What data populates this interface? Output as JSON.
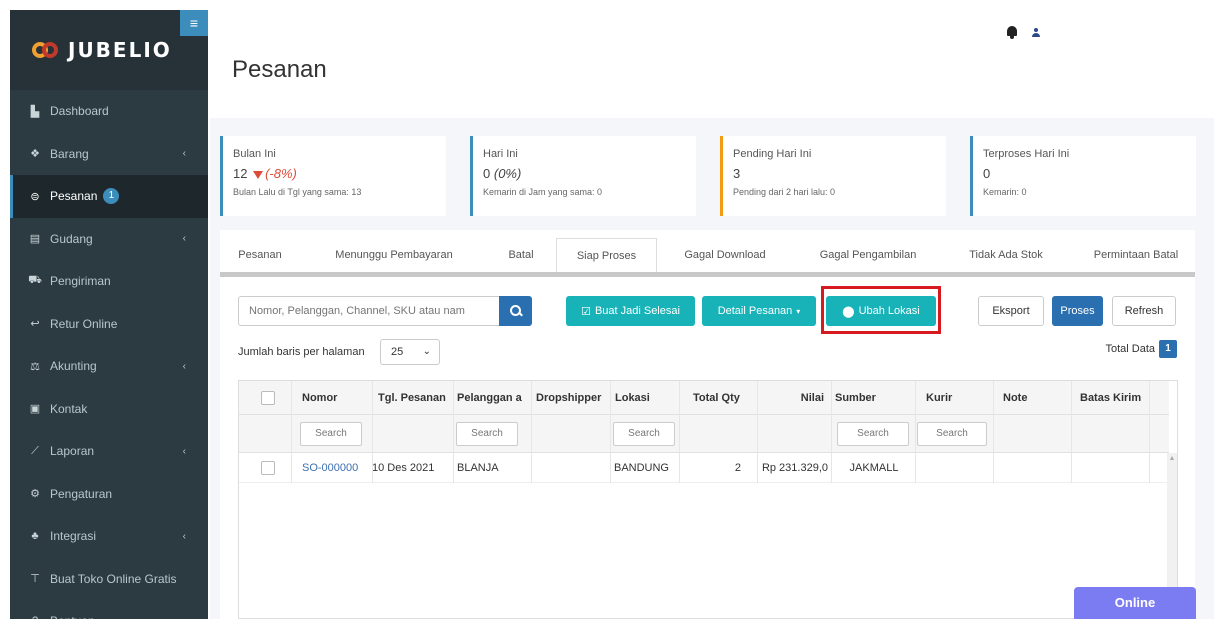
{
  "brand": {
    "name": "JUBELIO"
  },
  "sidebar": {
    "items": [
      {
        "label": "Dashboard",
        "icon": "dashboard-icon",
        "glyph": "▙",
        "chevron": false
      },
      {
        "label": "Barang",
        "icon": "cubes-icon",
        "glyph": "❖",
        "chevron": true
      },
      {
        "label": "Pesanan",
        "icon": "cart-icon",
        "glyph": "⊜",
        "chevron": false,
        "badge": "1",
        "active": true
      },
      {
        "label": "Gudang",
        "icon": "building-icon",
        "glyph": "▤",
        "chevron": true
      },
      {
        "label": "Pengiriman",
        "icon": "truck-icon",
        "glyph": "⛟",
        "chevron": false
      },
      {
        "label": "Retur Online",
        "icon": "reply-icon",
        "glyph": "↩",
        "chevron": false
      },
      {
        "label": "Akunting",
        "icon": "balance-scale-icon",
        "glyph": "⚖",
        "chevron": true
      },
      {
        "label": "Kontak",
        "icon": "address-card-icon",
        "glyph": "▣",
        "chevron": false
      },
      {
        "label": "Laporan",
        "icon": "line-chart-icon",
        "glyph": "⟋",
        "chevron": true
      },
      {
        "label": "Pengaturan",
        "icon": "cogs-icon",
        "glyph": "⚙",
        "chevron": false
      },
      {
        "label": "Integrasi",
        "icon": "sitemap-icon",
        "glyph": "♣",
        "chevron": true
      },
      {
        "label": "Buat Toko Online Gratis",
        "icon": "shopping-cart-icon",
        "glyph": "⊤",
        "chevron": false
      },
      {
        "label": "Bantuan",
        "icon": "question-circle-icon",
        "glyph": "?",
        "chevron": false
      }
    ]
  },
  "header": {
    "title": "Pesanan"
  },
  "stats": [
    {
      "label": "Bulan Ini",
      "value": "12",
      "change": "(-8%)",
      "sub": "Bulan Lalu di Tgl yang sama: 13"
    },
    {
      "label": "Hari Ini",
      "value": "0",
      "change": "(0%)",
      "sub": "Kemarin di Jam yang sama: 0"
    },
    {
      "label": "Pending Hari Ini",
      "value": "3",
      "change": "",
      "sub": "Pending dari 2 hari lalu: 0"
    },
    {
      "label": "Terproses Hari Ini",
      "value": "0",
      "change": "",
      "sub": "Kemarin: 0"
    }
  ],
  "colors": {
    "accent": "#3c8dbc",
    "teal": "#17b3b8",
    "warning": "#f39c12",
    "danger": "#dd4b39",
    "online": "#7c7cf2"
  },
  "tabs": [
    "Pesanan",
    "Menunggu Pembayaran",
    "Batal",
    "Siap Proses",
    "Gagal Download",
    "Gagal Pengambilan",
    "Tidak Ada Stok",
    "Permintaan Batal"
  ],
  "toolbar": {
    "search_placeholder": "Nomor, Pelanggan, Channel, SKU atau nam",
    "buat_jadi_selesai": "Buat Jadi Selesai",
    "detail_pesanan": "Detail Pesanan",
    "ubah_lokasi": "Ubah Lokasi",
    "eksport": "Eksport",
    "proses": "Proses",
    "refresh": "Refresh"
  },
  "paging": {
    "rows_label": "Jumlah baris per halaman",
    "rows_value": "25",
    "total_label": "Total Data",
    "total_value": "1"
  },
  "table": {
    "columns": [
      "Nomor",
      "Tgl. Pesanan",
      "Pelanggan a",
      "Dropshipper",
      "Lokasi",
      "Total Qty",
      "Nilai",
      "Sumber",
      "Kurir",
      "Note",
      "Batas Kirim"
    ],
    "filter_placeholder": "Search",
    "rows": [
      {
        "nomor": "SO-000000",
        "tgl": "10 Des 2021",
        "pelanggan": "BLANJA",
        "dropshipper": "",
        "lokasi": "BANDUNG",
        "qty": "2",
        "nilai": "Rp 231.329,0",
        "sumber": "JAKMALL",
        "kurir": "",
        "note": "",
        "batas": ""
      }
    ]
  },
  "chat": {
    "label": "Online"
  }
}
